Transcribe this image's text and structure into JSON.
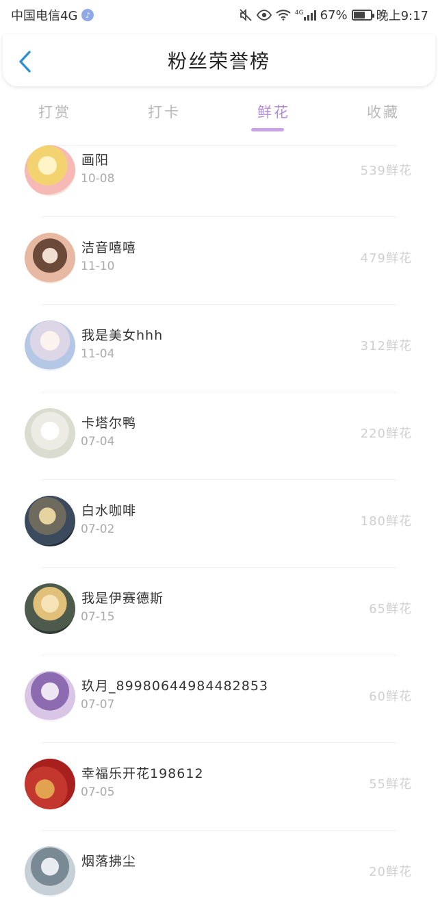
{
  "status_bar": {
    "carrier": "中国电信4G",
    "music_icon": "music-note-icon",
    "network_label": "4G",
    "battery_level": "67%",
    "battery_fraction": 0.67,
    "time": "晚上9:17"
  },
  "nav": {
    "back_icon": "chevron-left-icon",
    "title": "粉丝荣誉榜",
    "accent_color": "#2e8fd6"
  },
  "tabs": [
    {
      "label": "打赏",
      "active": false
    },
    {
      "label": "打卡",
      "active": false
    },
    {
      "label": "鲜花",
      "active": true
    },
    {
      "label": "收藏",
      "active": false
    }
  ],
  "active_tab_color": "#b38ad9",
  "fans": [
    {
      "name": "画阳",
      "date": "10-08",
      "count": "539鲜花"
    },
    {
      "name": "洁音嘻嘻",
      "date": "11-10",
      "count": "479鲜花"
    },
    {
      "name": "我是美女hhh",
      "date": "11-04",
      "count": "312鲜花"
    },
    {
      "name": "卡塔尔鸭",
      "date": "07-04",
      "count": "220鲜花"
    },
    {
      "name": "白水咖啡",
      "date": "07-02",
      "count": "180鲜花"
    },
    {
      "name": "我是伊赛德斯",
      "date": "07-15",
      "count": "65鲜花"
    },
    {
      "name": "玖月_89980644984482853",
      "date": "07-07",
      "count": "60鲜花"
    },
    {
      "name": "幸福乐开花198612",
      "date": "07-05",
      "count": "55鲜花"
    },
    {
      "name": "烟落拂尘",
      "date": "",
      "count": "20鲜花"
    }
  ]
}
